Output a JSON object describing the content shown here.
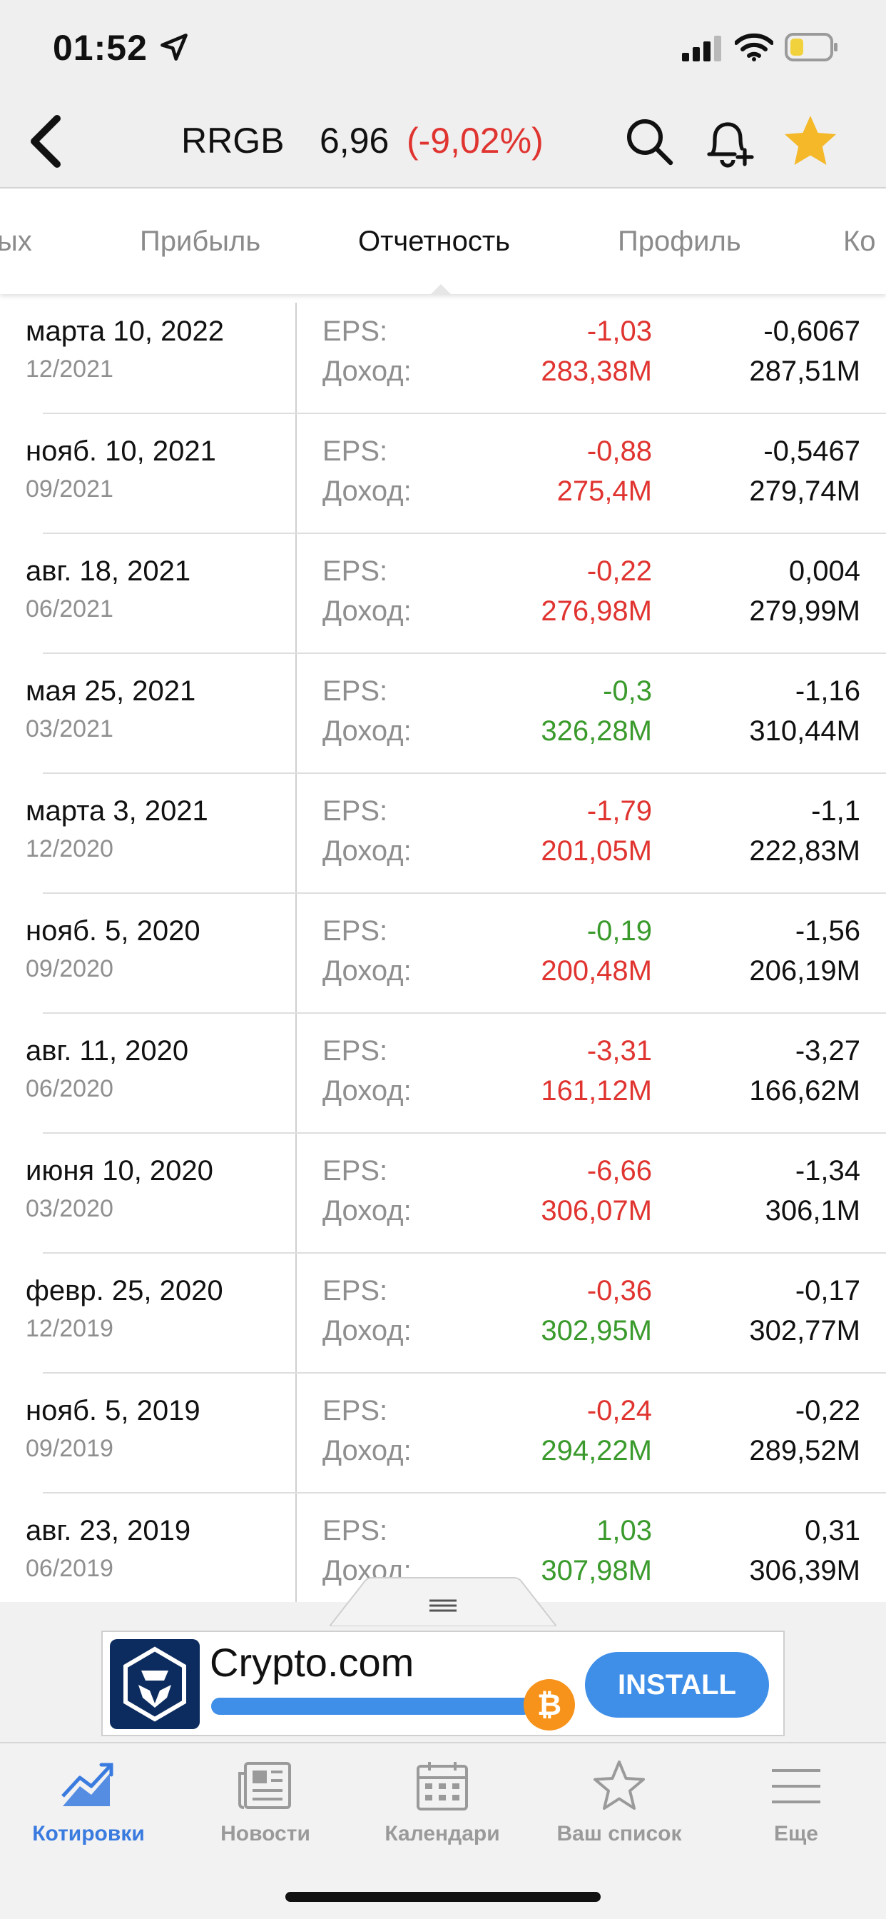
{
  "status": {
    "time": "01:52"
  },
  "header": {
    "ticker": "RRGB",
    "price": "6,96",
    "change": "(-9,02%)"
  },
  "tabs": [
    {
      "label": "ых"
    },
    {
      "label": "Прибыль"
    },
    {
      "label": "Отчетность"
    },
    {
      "label": "Профиль"
    },
    {
      "label": "Ко"
    }
  ],
  "labels": {
    "eps": "EPS:",
    "revenue": "Доход:"
  },
  "rows": [
    {
      "date": "марта 10, 2022",
      "period": "12/2021",
      "eps_actual": "-1,03",
      "eps_color": "#e03430",
      "eps_forecast": "-0,6067",
      "rev_actual": "283,38M",
      "rev_color": "#e03430",
      "rev_forecast": "287,51M"
    },
    {
      "date": "нояб. 10, 2021",
      "period": "09/2021",
      "eps_actual": "-0,88",
      "eps_color": "#e03430",
      "eps_forecast": "-0,5467",
      "rev_actual": "275,4M",
      "rev_color": "#e03430",
      "rev_forecast": "279,74M"
    },
    {
      "date": "авг. 18, 2021",
      "period": "06/2021",
      "eps_actual": "-0,22",
      "eps_color": "#e03430",
      "eps_forecast": "0,004",
      "rev_actual": "276,98M",
      "rev_color": "#e03430",
      "rev_forecast": "279,99M"
    },
    {
      "date": "мая 25, 2021",
      "period": "03/2021",
      "eps_actual": "-0,3",
      "eps_color": "#3a9a2c",
      "eps_forecast": "-1,16",
      "rev_actual": "326,28M",
      "rev_color": "#3a9a2c",
      "rev_forecast": "310,44M"
    },
    {
      "date": "марта 3, 2021",
      "period": "12/2020",
      "eps_actual": "-1,79",
      "eps_color": "#e03430",
      "eps_forecast": "-1,1",
      "rev_actual": "201,05M",
      "rev_color": "#e03430",
      "rev_forecast": "222,83M"
    },
    {
      "date": "нояб. 5, 2020",
      "period": "09/2020",
      "eps_actual": "-0,19",
      "eps_color": "#3a9a2c",
      "eps_forecast": "-1,56",
      "rev_actual": "200,48M",
      "rev_color": "#e03430",
      "rev_forecast": "206,19M"
    },
    {
      "date": "авг. 11, 2020",
      "period": "06/2020",
      "eps_actual": "-3,31",
      "eps_color": "#e03430",
      "eps_forecast": "-3,27",
      "rev_actual": "161,12M",
      "rev_color": "#e03430",
      "rev_forecast": "166,62M"
    },
    {
      "date": "июня 10, 2020",
      "period": "03/2020",
      "eps_actual": "-6,66",
      "eps_color": "#e03430",
      "eps_forecast": "-1,34",
      "rev_actual": "306,07M",
      "rev_color": "#e03430",
      "rev_forecast": "306,1M"
    },
    {
      "date": "февр. 25, 2020",
      "period": "12/2019",
      "eps_actual": "-0,36",
      "eps_color": "#e03430",
      "eps_forecast": "-0,17",
      "rev_actual": "302,95M",
      "rev_color": "#3a9a2c",
      "rev_forecast": "302,77M"
    },
    {
      "date": "нояб. 5, 2019",
      "period": "09/2019",
      "eps_actual": "-0,24",
      "eps_color": "#e03430",
      "eps_forecast": "-0,22",
      "rev_actual": "294,22M",
      "rev_color": "#3a9a2c",
      "rev_forecast": "289,52M"
    },
    {
      "date": "авг. 23, 2019",
      "period": "06/2019",
      "eps_actual": "1,03",
      "eps_color": "#3a9a2c",
      "eps_forecast": "0,31",
      "rev_actual": "307,98M",
      "rev_color": "#3a9a2c",
      "rev_forecast": "306,39M"
    }
  ],
  "ad": {
    "title": "Crypto.com",
    "button": "INSTALL"
  },
  "bottom_nav": [
    {
      "label": "Котировки",
      "icon": "chart-trend-icon",
      "active": true
    },
    {
      "label": "Новости",
      "icon": "newspaper-icon",
      "active": false
    },
    {
      "label": "Календари",
      "icon": "calendar-icon",
      "active": false
    },
    {
      "label": "Ваш список",
      "icon": "star-outline-icon",
      "active": false
    },
    {
      "label": "Еще",
      "icon": "menu-icon",
      "active": false
    }
  ]
}
